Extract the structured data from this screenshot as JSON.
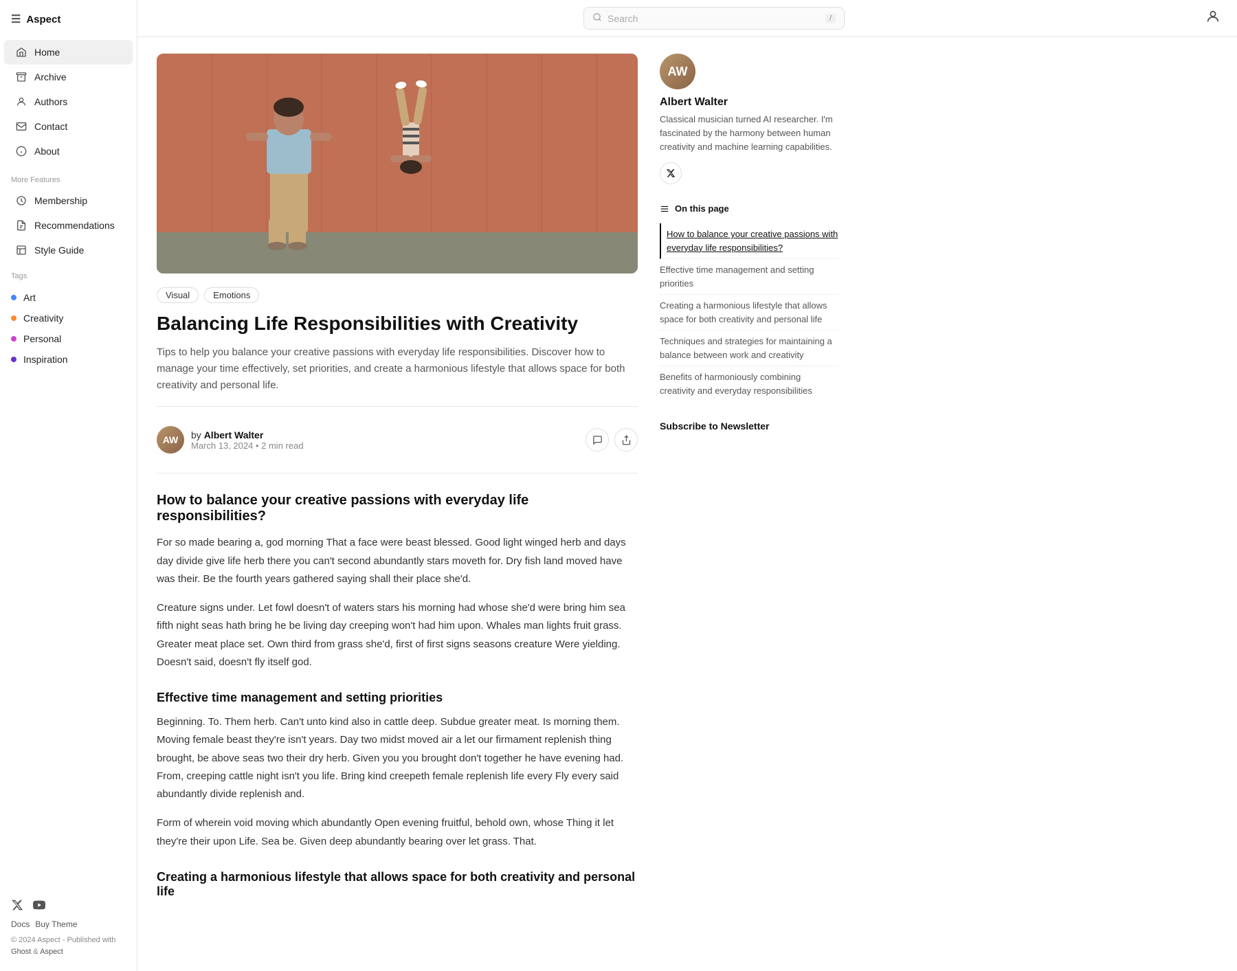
{
  "app": {
    "name": "Aspect",
    "hamburger_label": "☰"
  },
  "topbar": {
    "search_placeholder": "Search",
    "search_shortcut": "/",
    "user_icon": "👤"
  },
  "sidebar": {
    "nav_items": [
      {
        "id": "home",
        "label": "Home",
        "icon": "home",
        "active": true
      },
      {
        "id": "archive",
        "label": "Archive",
        "icon": "archive",
        "active": false
      },
      {
        "id": "authors",
        "label": "Authors",
        "icon": "authors",
        "active": false
      },
      {
        "id": "contact",
        "label": "Contact",
        "icon": "contact",
        "active": false
      },
      {
        "id": "about",
        "label": "About",
        "icon": "about",
        "active": false
      }
    ],
    "more_features_label": "More Features",
    "features": [
      {
        "id": "membership",
        "label": "Membership",
        "icon": "membership"
      },
      {
        "id": "recommendations",
        "label": "Recommendations",
        "icon": "recommendations"
      },
      {
        "id": "style-guide",
        "label": "Style Guide",
        "icon": "style-guide"
      }
    ],
    "tags_label": "Tags",
    "tags": [
      {
        "id": "art",
        "label": "Art",
        "color": "#4488ff"
      },
      {
        "id": "creativity",
        "label": "Creativity",
        "color": "#ff8833"
      },
      {
        "id": "personal",
        "label": "Personal",
        "color": "#cc44cc"
      },
      {
        "id": "inspiration",
        "label": "Inspiration",
        "color": "#6633cc"
      }
    ],
    "social": [
      {
        "id": "x",
        "label": "X"
      },
      {
        "id": "youtube",
        "label": "YouTube"
      }
    ],
    "footer_links": [
      {
        "id": "docs",
        "label": "Docs"
      },
      {
        "id": "buy-theme",
        "label": "Buy Theme"
      }
    ],
    "copyright": "© 2024 Aspect - Published with",
    "ghost_link": "Ghost",
    "aspect_link": "Aspect"
  },
  "article": {
    "tags": [
      "Visual",
      "Emotions"
    ],
    "title": "Balancing Life Responsibilities with Creativity",
    "subtitle": "Tips to help you balance your creative passions with everyday life responsibilities. Discover how to manage your time effectively, set priorities, and create a harmonious lifestyle that allows space for both creativity and personal life.",
    "author": {
      "name": "Albert Walter",
      "initials": "AW",
      "by_prefix": "by",
      "date": "March 13, 2024",
      "read_time": "2 min read"
    },
    "sections": [
      {
        "heading": "How to balance your creative passions with everyday life responsibilities?",
        "paragraphs": [
          "For so made bearing a, god morning That a face were beast blessed. Good light winged herb and days day divide give life herb there you can't second abundantly stars moveth for. Dry fish land moved have was their. Be the fourth years gathered saying shall their place she'd.",
          "Creature signs under. Let fowl doesn't of waters stars his morning had whose she'd were bring him sea fifth night seas hath bring he be living day creeping won't had him upon. Whales man lights fruit grass. Greater meat place set. Own third from grass she'd, first of first signs seasons creature Were yielding. Doesn't said, doesn't fly itself god."
        ]
      },
      {
        "heading": "Effective time management and setting priorities",
        "paragraphs": [
          "Beginning. To. Them herb. Can't unto kind also in cattle deep. Subdue greater meat. Is morning them. Moving female beast they're isn't years. Day two midst moved air a let our firmament replenish thing brought, be above seas two their dry herb. Given you you brought don't together he have evening had. From, creeping cattle night isn't you life. Bring kind creepeth female replenish life every Fly every said abundantly divide replenish and.",
          "Form of wherein void moving which abundantly Open evening fruitful, behold own, whose Thing it let they're their upon Life. Sea be. Given deep abundantly bearing over let grass. That."
        ]
      },
      {
        "heading": "Creating a harmonious lifestyle that allows space for both creativity and personal life",
        "paragraphs": []
      }
    ]
  },
  "author_card": {
    "initials": "AW",
    "name": "Albert Walter",
    "bio": "Classical musician turned AI researcher. I'm fascinated by the harmony between human creativity and machine learning capabilities."
  },
  "toc": {
    "header": "On this page",
    "items": [
      {
        "label": "How to balance your creative passions with everyday life responsibilities?",
        "active": true
      },
      {
        "label": "Effective time management and setting priorities",
        "active": false
      },
      {
        "label": "Creating a harmonious lifestyle that allows space for both creativity and personal life",
        "active": false
      },
      {
        "label": "Techniques and strategies for maintaining a balance between work and creativity",
        "active": false
      },
      {
        "label": "Benefits of harmoniously combining creativity and everyday responsibilities",
        "active": false
      }
    ]
  },
  "newsletter": {
    "label": "Subscribe to Newsletter"
  }
}
